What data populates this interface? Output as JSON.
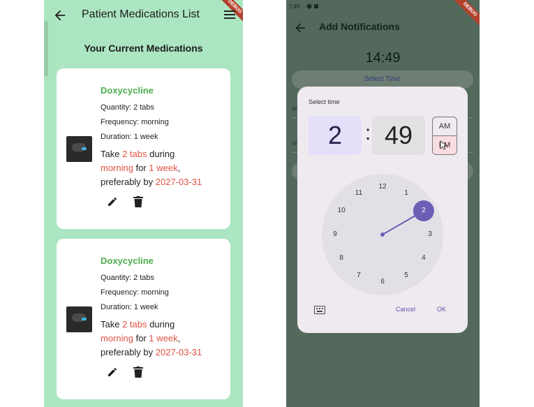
{
  "left_screen": {
    "title": "Patient Medications List",
    "section_heading": "Your Current Medications",
    "debug_banner": "DEBUG",
    "cards": [
      {
        "name": "Doxycycline",
        "quantity": "Quantity: 2 tabs",
        "frequency": "Frequency: morning",
        "duration": "Duration: 1 week",
        "sentence": {
          "take": "Take ",
          "dose": "2 tabs",
          "during": " during",
          "time": "morning",
          "for": " for ",
          "period": "1 week",
          "comma": ",",
          "preferably": "preferably by ",
          "date": "2027-03-31"
        },
        "edit_icon": "pencil-icon",
        "delete_icon": "trash-icon"
      },
      {
        "name": "Doxycycline",
        "quantity": "Quantity: 2 tabs",
        "frequency": "Frequency: morning",
        "duration": "Duration: 1 week",
        "sentence": {
          "take": "Take ",
          "dose": "2 tabs",
          "during": " during",
          "time": "morning",
          "for": " for ",
          "period": "1 week",
          "comma": ",",
          "preferably": "preferably by ",
          "date": "2027-03-31"
        },
        "edit_icon": "pencil-icon",
        "delete_icon": "trash-icon"
      }
    ],
    "colors": {
      "background": "#ace5c2",
      "drug_name": "#4caf50",
      "highlight": "#e05244"
    }
  },
  "right_screen": {
    "status_time": "2:49",
    "title": "Add Notifications",
    "debug_banner": "DEBUG",
    "clock_text": "14:49",
    "select_time_label": "Select Time",
    "bg_field_letters": [
      "te",
      "te"
    ],
    "dialog": {
      "label": "Select time",
      "hour": "2",
      "separator": ":",
      "minute": "49",
      "am_label": "AM",
      "pm_label": "PM",
      "selected_period": "PM",
      "selected_hour": 2,
      "dial_numbers": [
        "12",
        "1",
        "2",
        "3",
        "4",
        "5",
        "6",
        "7",
        "8",
        "9",
        "10",
        "11"
      ],
      "cancel_label": "Cancel",
      "ok_label": "OK",
      "keyboard_icon": "keyboard-icon"
    },
    "colors": {
      "scrim": "#52695b",
      "dialog": "#efeaf0",
      "accent": "#6a5fb5",
      "hour_box": "#e5e0f9",
      "pm_selected": "#f7dce0"
    }
  }
}
